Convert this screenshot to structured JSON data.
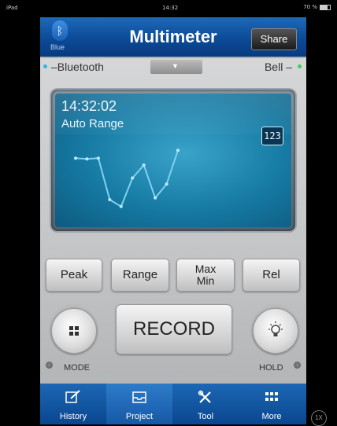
{
  "status_bar": {
    "device": "iPad",
    "time": "14:32",
    "battery": "70 %"
  },
  "header": {
    "bluetooth_label": "Blue",
    "title": "Multimeter",
    "share_label": "Share"
  },
  "connection": {
    "bluetooth": "Bluetooth",
    "bell": "Bell",
    "bluetooth_dot_color": "#2ab7e8",
    "bell_dot_color": "#3ecf5a"
  },
  "display": {
    "time": "14:32:02",
    "mode": "Auto Range",
    "numeric_toggle": "123",
    "trace": [
      0.22,
      0.23,
      0.22,
      0.7,
      0.78,
      0.45,
      0.3,
      0.68,
      0.52,
      0.13
    ]
  },
  "function_buttons": [
    {
      "label": "Peak"
    },
    {
      "label": "Range"
    },
    {
      "label": "Max\nMin"
    },
    {
      "label": "Rel"
    }
  ],
  "record_label": "RECORD",
  "mode_label": "MODE",
  "hold_label": "HOLD",
  "tabs": [
    {
      "label": "History",
      "icon": "edit-icon"
    },
    {
      "label": "Project",
      "icon": "inbox-icon",
      "selected": true
    },
    {
      "label": "Tool",
      "icon": "tools-icon"
    },
    {
      "label": "More",
      "icon": "grid-icon"
    }
  ],
  "zoom_label": "1X"
}
